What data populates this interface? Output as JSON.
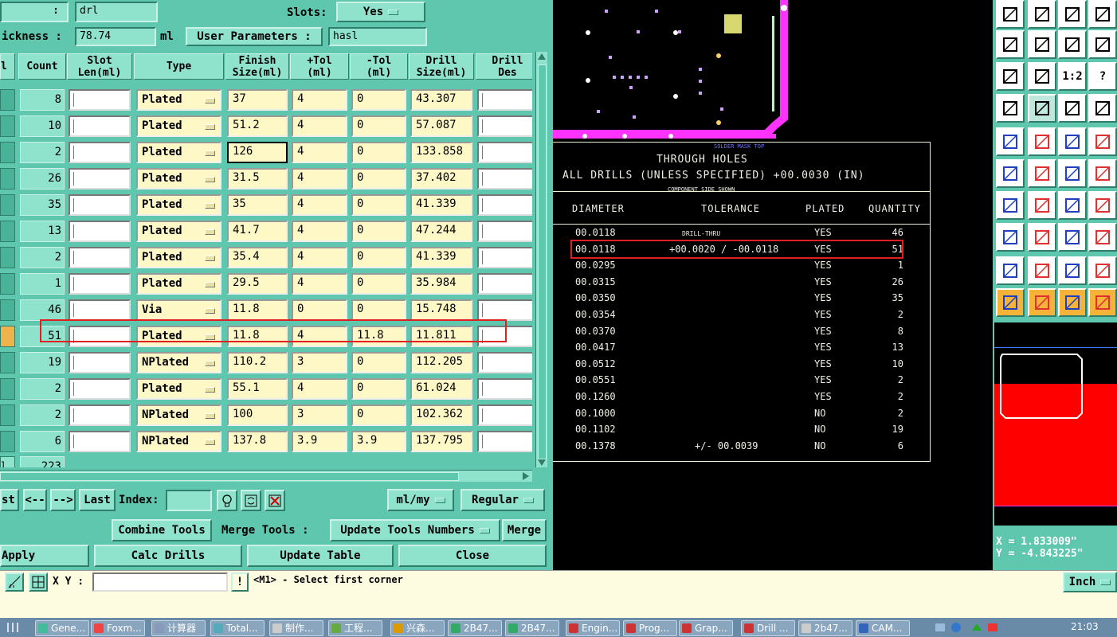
{
  "dialog": {
    "name_label": ":",
    "name_value": "drl",
    "slots_label": "Slots:",
    "slots_value": "Yes",
    "thickness_label": "ickness :",
    "thickness_value": "78.74",
    "thickness_unit": "ml",
    "user_params_label": "User Parameters :",
    "user_params_value": "hasl",
    "columns": [
      "l",
      "Count",
      "Slot\nLen(ml)",
      "Type",
      "Finish\nSize(ml)",
      "+Tol\n(ml)",
      "-Tol\n(ml)",
      "Drill\nSize(ml)",
      "Drill\nDes"
    ],
    "rows": [
      {
        "count": "8",
        "type": "Plated",
        "finish": "37",
        "ptol": "4",
        "mtol": "0",
        "drill": "43.307"
      },
      {
        "count": "10",
        "type": "Plated",
        "finish": "51.2",
        "ptol": "4",
        "mtol": "0",
        "drill": "57.087"
      },
      {
        "count": "2",
        "type": "Plated",
        "finish": "126",
        "ptol": "4",
        "mtol": "0",
        "drill": "133.858"
      },
      {
        "count": "26",
        "type": "Plated",
        "finish": "31.5",
        "ptol": "4",
        "mtol": "0",
        "drill": "37.402"
      },
      {
        "count": "35",
        "type": "Plated",
        "finish": "35",
        "ptol": "4",
        "mtol": "0",
        "drill": "41.339"
      },
      {
        "count": "13",
        "type": "Plated",
        "finish": "41.7",
        "ptol": "4",
        "mtol": "0",
        "drill": "47.244"
      },
      {
        "count": "2",
        "type": "Plated",
        "finish": "35.4",
        "ptol": "4",
        "mtol": "0",
        "drill": "41.339"
      },
      {
        "count": "1",
        "type": "Plated",
        "finish": "29.5",
        "ptol": "4",
        "mtol": "0",
        "drill": "35.984"
      },
      {
        "count": "46",
        "type": "Via",
        "finish": "11.8",
        "ptol": "0",
        "mtol": "0",
        "drill": "15.748"
      },
      {
        "count": "51",
        "type": "Plated",
        "finish": "11.8",
        "ptol": "4",
        "mtol": "11.8",
        "drill": "11.811"
      },
      {
        "count": "19",
        "type": "NPlated",
        "finish": "110.2",
        "ptol": "3",
        "mtol": "0",
        "drill": "112.205"
      },
      {
        "count": "2",
        "type": "Plated",
        "finish": "55.1",
        "ptol": "4",
        "mtol": "0",
        "drill": "61.024"
      },
      {
        "count": "2",
        "type": "NPlated",
        "finish": "100",
        "ptol": "3",
        "mtol": "0",
        "drill": "102.362"
      },
      {
        "count": "6",
        "type": "NPlated",
        "finish": "137.8",
        "ptol": "3.9",
        "mtol": "3.9",
        "drill": "137.795"
      }
    ],
    "total_first": "l",
    "total_count": "223",
    "nav": {
      "first": "st",
      "prev": "<--",
      "next": "-->",
      "last": "Last",
      "index_label": "Index:",
      "index_value": "",
      "units": "ml/my",
      "mode": "Regular"
    },
    "tools_row": {
      "combine": "Combine Tools",
      "merge_label": "Merge Tools :",
      "update_numbers": "Update Tools Numbers",
      "merge": "Merge"
    },
    "actions": {
      "apply": "Apply",
      "calc": "Calc Drills",
      "update": "Update Table",
      "close": "Close"
    }
  },
  "drill_table": {
    "silk_label": "SOLDER MASK TOP",
    "title": "THROUGH HOLES",
    "subtitle": "ALL DRILLS (UNLESS SPECIFIED) +00.0030 (IN)",
    "note": "COMPONENT SIDE SHOWN",
    "headers": [
      "DIAMETER",
      "TOLERANCE",
      "PLATED",
      "QUANTITY"
    ],
    "rows": [
      {
        "diameter": "00.0118",
        "tolerance": "DRILL-THRU",
        "plated": "YES",
        "qty": "46"
      },
      {
        "diameter": "00.0118",
        "tolerance": "+00.0020 / -00.0118",
        "plated": "YES",
        "qty": "51"
      },
      {
        "diameter": "00.0295",
        "tolerance": "",
        "plated": "YES",
        "qty": "1"
      },
      {
        "diameter": "00.0315",
        "tolerance": "",
        "plated": "YES",
        "qty": "26"
      },
      {
        "diameter": "00.0350",
        "tolerance": "",
        "plated": "YES",
        "qty": "35"
      },
      {
        "diameter": "00.0354",
        "tolerance": "",
        "plated": "YES",
        "qty": "2"
      },
      {
        "diameter": "00.0370",
        "tolerance": "",
        "plated": "YES",
        "qty": "8"
      },
      {
        "diameter": "00.0417",
        "tolerance": "",
        "plated": "YES",
        "qty": "13"
      },
      {
        "diameter": "00.0512",
        "tolerance": "",
        "plated": "YES",
        "qty": "10"
      },
      {
        "diameter": "00.0551",
        "tolerance": "",
        "plated": "YES",
        "qty": "2"
      },
      {
        "diameter": "00.1260",
        "tolerance": "",
        "plated": "YES",
        "qty": "2"
      },
      {
        "diameter": "00.1000",
        "tolerance": "",
        "plated": "NO",
        "qty": "2"
      },
      {
        "diameter": "00.1102",
        "tolerance": "",
        "plated": "NO",
        "qty": "19"
      },
      {
        "diameter": "00.1378",
        "tolerance": "+/- 00.0039",
        "plated": "NO",
        "qty": "6"
      }
    ]
  },
  "toolbox": {
    "scale_label": "1:2",
    "help_label": "?",
    "coord_x": "X = 1.833009\"",
    "coord_y": "Y = -4.843225\""
  },
  "status": {
    "xy_label": "X Y :",
    "xy_value": "",
    "warn": "!",
    "message": "<M1> - Select first corner",
    "units": "Inch"
  },
  "taskbar": {
    "items": [
      "Gene...",
      "Foxm...",
      "计算器",
      "Total...",
      "制作...",
      "工程...",
      "兴森...",
      "2B47...",
      "2B47...",
      "Engin...",
      "Prog...",
      "Grap...",
      "Drill ...",
      "2b47...",
      "CAM..."
    ],
    "time": "21:03"
  },
  "colors": {
    "dialog_bg": "#5fc7ae",
    "cell_yellow": "#fdf8c6",
    "highlight_red": "#e02020",
    "board_magenta": "#ff33ff"
  }
}
